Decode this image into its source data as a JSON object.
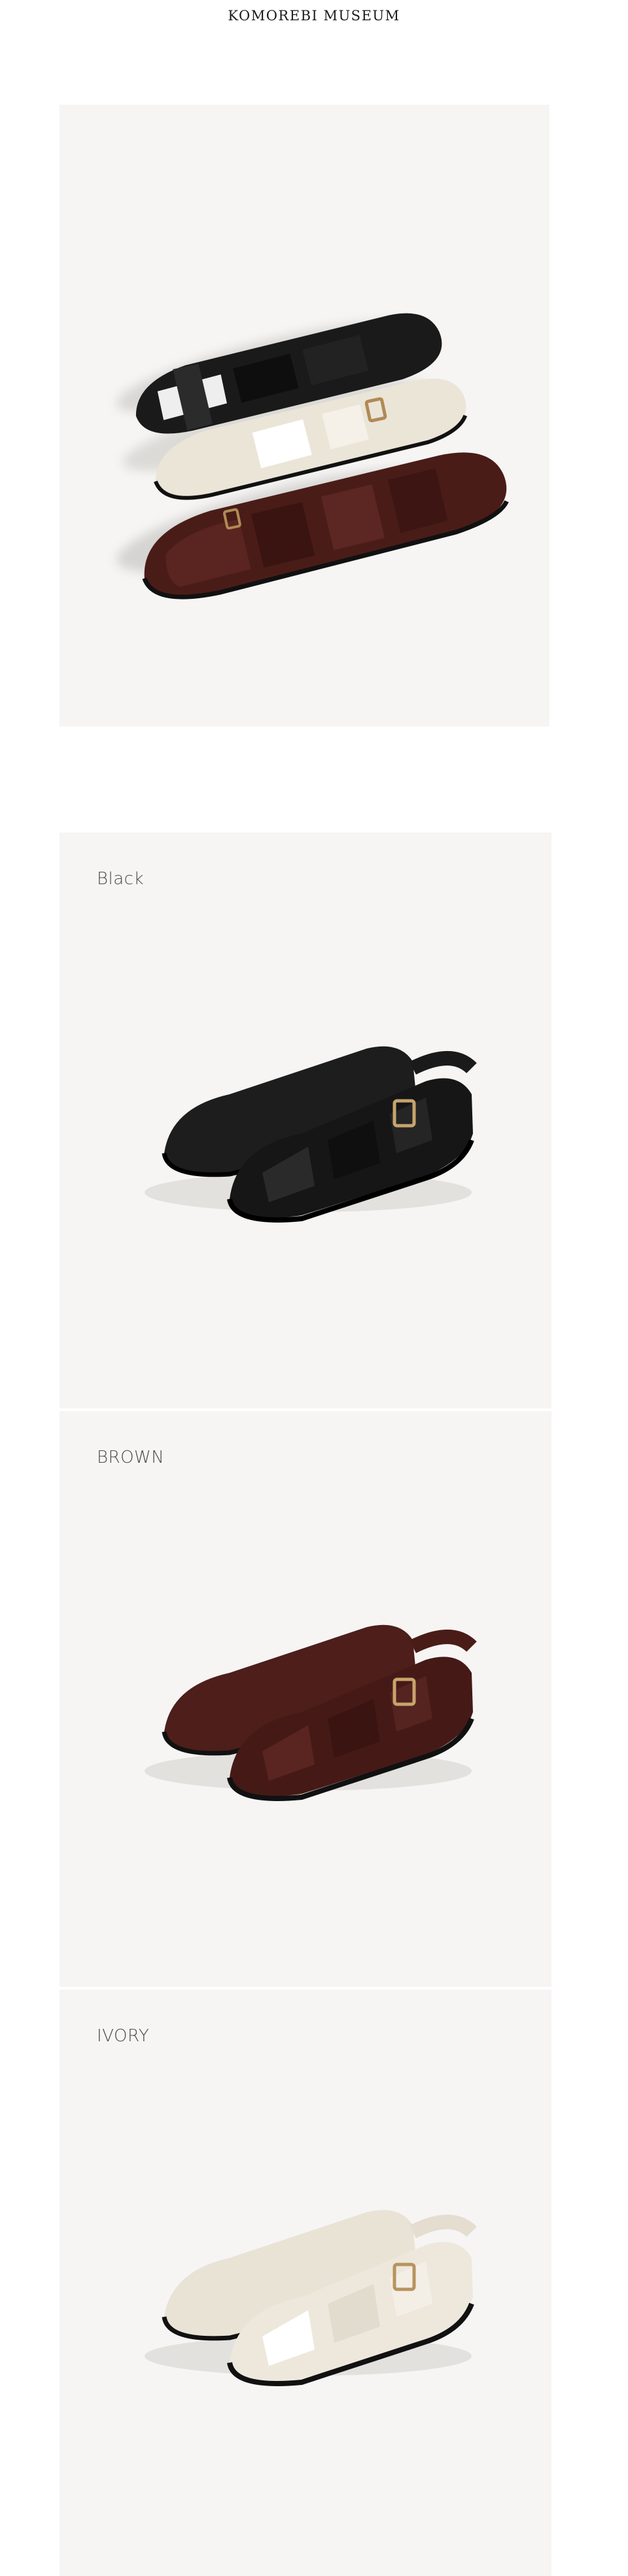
{
  "header": {
    "brand": "KOMOREBI MUSEUM"
  },
  "colors": {
    "panel_bg": "#f6f5f4",
    "black": "#1b1b1b",
    "brown": "#4a1c18",
    "ivory": "#ece6da"
  },
  "variants": [
    {
      "label": "Black"
    },
    {
      "label": "BROWN"
    },
    {
      "label": "IVORY"
    }
  ]
}
